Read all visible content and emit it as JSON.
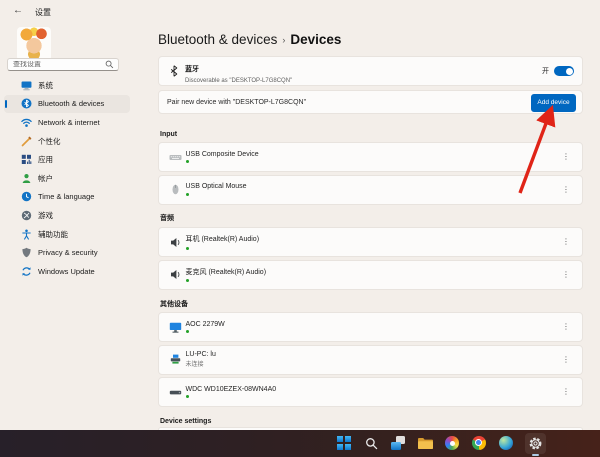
{
  "window": {
    "title": "设置",
    "back_glyph": "←"
  },
  "icons": {
    "more_glyph": "⋮"
  },
  "sidebar": {
    "search_placeholder": "查找设置",
    "items": [
      {
        "label": "系统",
        "icon": "system"
      },
      {
        "label": "Bluetooth & devices",
        "icon": "bluetooth",
        "active": true
      },
      {
        "label": "Network & internet",
        "icon": "network"
      },
      {
        "label": "个性化",
        "icon": "personalization"
      },
      {
        "label": "应用",
        "icon": "apps"
      },
      {
        "label": "帐户",
        "icon": "accounts"
      },
      {
        "label": "Time & language",
        "icon": "time-language"
      },
      {
        "label": "游戏",
        "icon": "gaming"
      },
      {
        "label": "辅助功能",
        "icon": "accessibility"
      },
      {
        "label": "Privacy & security",
        "icon": "privacy-security"
      },
      {
        "label": "Windows Update",
        "icon": "windows-update"
      }
    ]
  },
  "main": {
    "breadcrumb": {
      "parent": "Bluetooth & devices",
      "separator": "›",
      "current": "Devices"
    },
    "bluetooth_card": {
      "name": "蓝牙",
      "description": "Discoverable as \"DESKTOP-L7G8CQN\"",
      "toggle_label": "开",
      "toggle_state": "on"
    },
    "pair_card": {
      "label": "Pair new device with \"DESKTOP-L7G8CQN\"",
      "button_label": "Add device"
    },
    "sections": [
      {
        "title": "Input",
        "devices": [
          {
            "name": "USB Composite Device",
            "icon": "keyboard",
            "status": "connected"
          },
          {
            "name": "USB Optical Mouse",
            "icon": "mouse",
            "status": "connected"
          }
        ]
      },
      {
        "title": "音频",
        "devices": [
          {
            "name": "耳机 (Realtek(R) Audio)",
            "icon": "speaker",
            "status": "connected"
          },
          {
            "name": "麦克风 (Realtek(R) Audio)",
            "icon": "speaker",
            "status": "connected"
          }
        ]
      },
      {
        "title": "其他设备",
        "devices": [
          {
            "name": "AOC 2279W",
            "icon": "monitor",
            "status": "connected"
          },
          {
            "name": "LU-PC: lu",
            "icon": "pc",
            "status_text": "未连接"
          },
          {
            "name": "WDC WD10EZEX-08WN4A0",
            "icon": "hard-drive",
            "status": "connected"
          }
        ]
      }
    ],
    "device_settings_label": "Device settings"
  },
  "annotation": {
    "arrow_color": "#e02417",
    "points_to": "Add device"
  },
  "taskbar": {
    "items": [
      "start",
      "search",
      "task-view",
      "file-explorer",
      "color-wheel-app",
      "chrome",
      "globe-app",
      "settings"
    ],
    "active_item": "settings"
  },
  "colors": {
    "accent": "#0067c0",
    "background": "#f3eee9",
    "card": "#fcfbfa",
    "status_ok": "#23a127",
    "taskbar_left": "#272029",
    "taskbar_right": "#46221a"
  }
}
